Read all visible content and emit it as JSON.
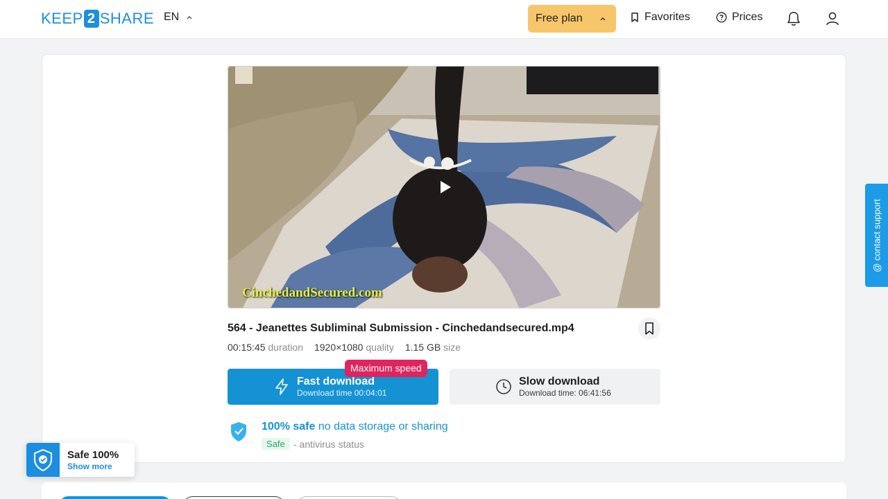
{
  "header": {
    "logo": {
      "left": "KEEP",
      "mid": "2",
      "right": "SHARE"
    },
    "language": "EN",
    "plan_label": "Free plan",
    "favorites_label": "Favorites",
    "prices_label": "Prices"
  },
  "video": {
    "watermark": "CinchedandSecured.com"
  },
  "file": {
    "title": "564 - Jeanettes Subliminal Submission - Cinchedandsecured.mp4",
    "duration": "00:15:45",
    "duration_unit": "duration",
    "quality": "1920×1080",
    "quality_unit": "quality",
    "size": "1.15 GB",
    "size_unit": "size"
  },
  "download": {
    "max_speed_badge": "Maximum speed",
    "fast_label": "Fast download",
    "fast_time": "Download time 00:04:01",
    "slow_label": "Slow download",
    "slow_time": "Download time: 06:41:56"
  },
  "safety": {
    "headline_bold": "100% safe",
    "headline_rest": "no data storage or sharing",
    "badge": "Safe",
    "status": "- antivirus status"
  },
  "contact_support": "@ contact support",
  "safe_widget": {
    "title": "Safe 100%",
    "link": "Show more"
  },
  "colors": {
    "accent": "#1592d4",
    "plan": "#f8c66a",
    "max_speed": "#e0245e"
  }
}
